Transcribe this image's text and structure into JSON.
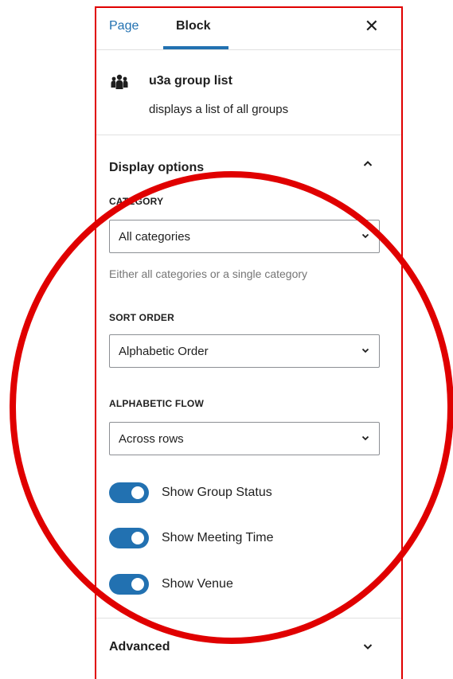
{
  "tabs": {
    "page_label": "Page",
    "block_label": "Block",
    "active": "Block"
  },
  "close_icon": "close-icon",
  "block": {
    "icon": "group-people-icon",
    "name": "u3a group list",
    "description": "displays a list of all groups"
  },
  "display_options": {
    "title": "Display options",
    "expanded": true,
    "category": {
      "label": "CATEGORY",
      "value": "All categories",
      "help": "Either all categories or a single category"
    },
    "sort_order": {
      "label": "SORT ORDER",
      "value": "Alphabetic Order"
    },
    "alphabetic_flow": {
      "label": "ALPHABETIC FLOW",
      "value": "Across rows"
    },
    "toggles": [
      {
        "label": "Show Group Status",
        "on": true
      },
      {
        "label": "Show Meeting Time",
        "on": true
      },
      {
        "label": "Show Venue",
        "on": true
      }
    ]
  },
  "advanced": {
    "title": "Advanced",
    "expanded": false
  },
  "colors": {
    "accent": "#2271b1",
    "annotation": "#e00000",
    "border": "#e0e0e0"
  }
}
